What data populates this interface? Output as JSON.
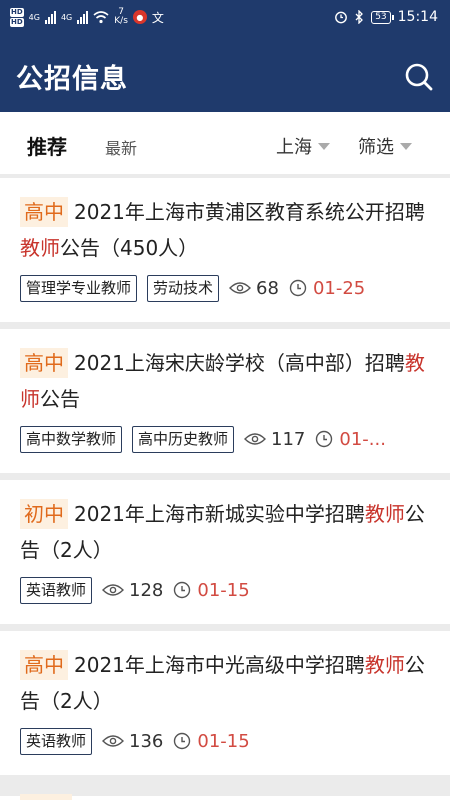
{
  "status_bar": {
    "hd1": "HD",
    "hd2": "HD",
    "net1": "4G",
    "net2": "4G",
    "speed_value": "7",
    "speed_unit": "K/s",
    "battery": "53",
    "time": "15:14"
  },
  "header": {
    "title": "公招信息",
    "search_icon": "search-icon"
  },
  "filters": {
    "tab_recommend": "推荐",
    "tab_latest": "最新",
    "region": "上海",
    "filter": "筛选"
  },
  "jobs": [
    {
      "level": "高中",
      "title_pre": "2021年上海市黄浦区教育系统公开招聘",
      "title_hl": "教师",
      "title_post": "公告（450人）",
      "tags": [
        "管理学专业教师",
        "劳动技术"
      ],
      "views": "68",
      "date": "01-25"
    },
    {
      "level": "高中",
      "title_pre": "2021上海宋庆龄学校（高中部）招聘",
      "title_hl": "教师",
      "title_post": "公告",
      "tags": [
        "高中数学教师",
        "高中历史教师"
      ],
      "views": "117",
      "date": "01-..."
    },
    {
      "level": "初中",
      "title_pre": "2021年上海市新城实验中学招聘",
      "title_hl": "教师",
      "title_post": "公告（2人）",
      "tags": [
        "英语教师"
      ],
      "views": "128",
      "date": "01-15"
    },
    {
      "level": "高中",
      "title_pre": "2021年上海市中光高级中学招聘",
      "title_hl": "教师",
      "title_post": "公告（2人）",
      "tags": [
        "英语教师"
      ],
      "views": "136",
      "date": "01-15"
    }
  ],
  "colors": {
    "header_bg": "#1f3a6c",
    "level_text": "#e06a1c",
    "level_bg": "#fdf0e0",
    "highlight": "#c8342c",
    "date": "#d24b42"
  }
}
